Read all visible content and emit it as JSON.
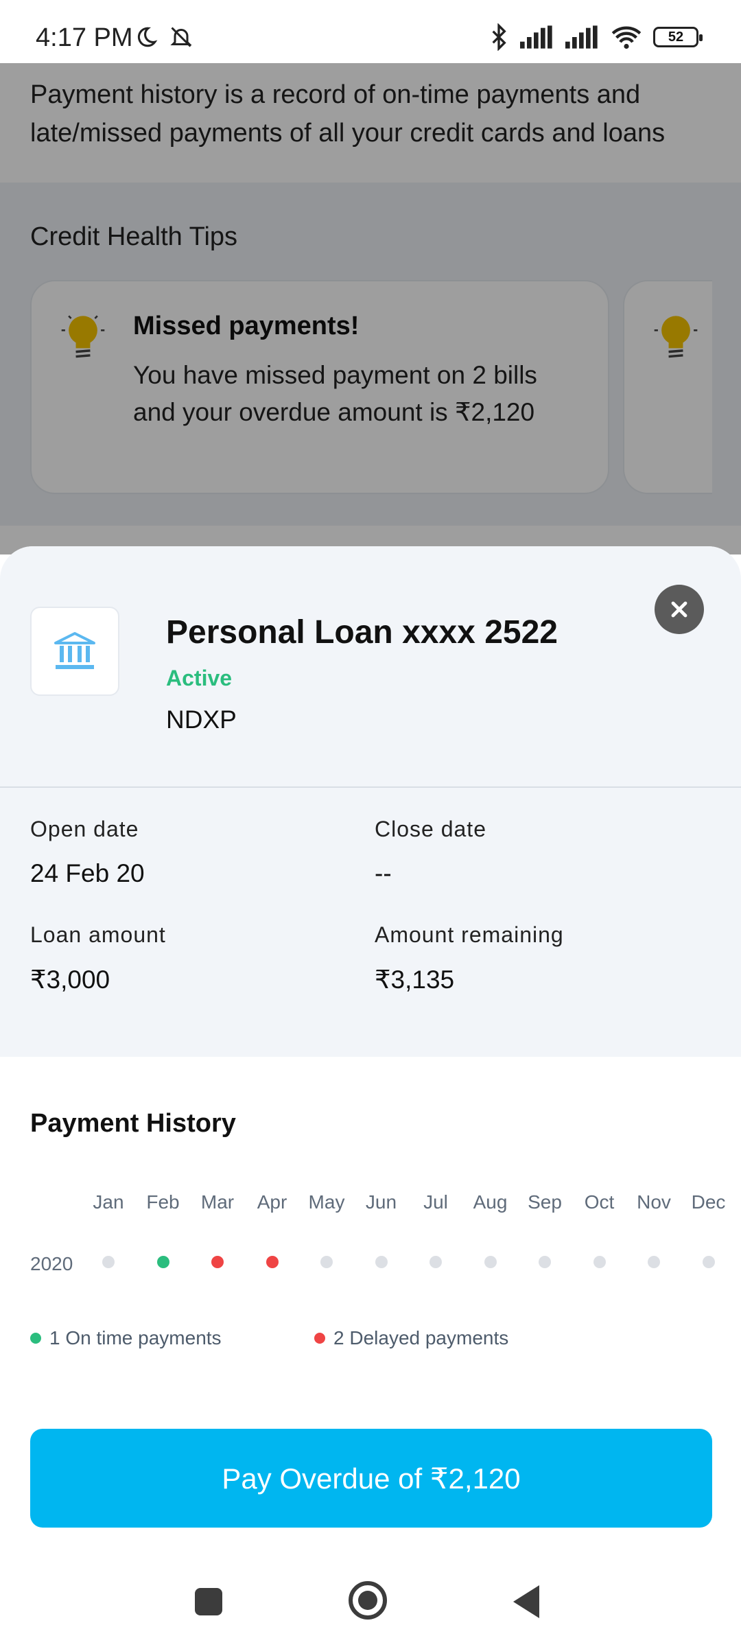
{
  "status_bar": {
    "time": "4:17 PM",
    "battery": "52"
  },
  "background": {
    "intro": "Payment history is a record of on-time payments and late/missed payments of all your credit cards and loans",
    "tips_title": "Credit Health Tips",
    "tip": {
      "title": "Missed payments!",
      "text": "You have missed payment on 2 bills and your overdue amount is ₹2,120"
    }
  },
  "sheet": {
    "title": "Personal Loan xxxx 2522",
    "status": "Active",
    "lender": "NDXP",
    "details": {
      "open_label": "Open date",
      "open_value": "24 Feb 20",
      "close_label": "Close date",
      "close_value": "--",
      "loan_label": "Loan amount",
      "loan_value": "₹3,000",
      "remaining_label": "Amount remaining",
      "remaining_value": "₹3,135"
    },
    "payment_history": {
      "title": "Payment History",
      "year": "2020",
      "months": [
        "Jan",
        "Feb",
        "Mar",
        "Apr",
        "May",
        "Jun",
        "Jul",
        "Aug",
        "Sep",
        "Oct",
        "Nov",
        "Dec"
      ],
      "statuses": [
        "none",
        "on-time",
        "delayed",
        "delayed",
        "none",
        "none",
        "none",
        "none",
        "none",
        "none",
        "none",
        "none"
      ],
      "legend_on_time": "1 On time payments",
      "legend_delayed": "2 Delayed payments"
    },
    "pay_button": "Pay Overdue of ₹2,120"
  },
  "colors": {
    "on_time": "#2bbd7e",
    "delayed": "#ef4444",
    "none": "#dcdfe4",
    "accent": "#00b6f0"
  }
}
